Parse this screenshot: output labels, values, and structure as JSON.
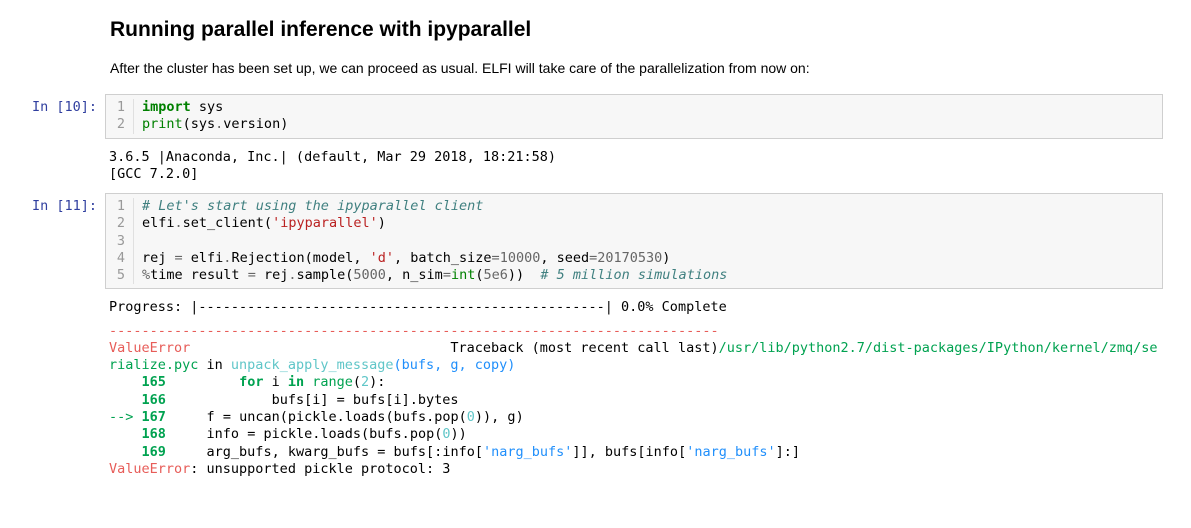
{
  "heading": "Running parallel inference with ipyparallel",
  "intro": "After the cluster has been set up, we can proceed as usual. ELFI will take care of the parallelization from now on:",
  "cells": [
    {
      "prompt": "In [10]:",
      "code": {
        "lines": [
          "1",
          "2"
        ],
        "l1_import": "import",
        "l1_sys": " sys",
        "l2_print": "print",
        "l2_open": "(sys",
        "l2_dot": ".",
        "l2_version": "version)"
      },
      "output": "3.6.5 |Anaconda, Inc.| (default, Mar 29 2018, 18:21:58) \n[GCC 7.2.0]"
    },
    {
      "prompt": "In [11]:",
      "code": {
        "lines": [
          "1",
          "2",
          "3",
          "4",
          "5"
        ],
        "l1_cm": "# Let's start using the ipyparallel client",
        "l2_a": "elfi",
        "l2_b": ".",
        "l2_c": "set_client(",
        "l2_str": "'ipyparallel'",
        "l2_d": ")",
        "l4_a": "rej ",
        "l4_eq": "=",
        "l4_b": " elfi",
        "l4_dot1": ".",
        "l4_c": "Rejection(model, ",
        "l4_str": "'d'",
        "l4_d": ", batch_size",
        "l4_eq2": "=",
        "l4_num1": "10000",
        "l4_e": ", seed",
        "l4_eq3": "=",
        "l4_num2": "20170530",
        "l4_f": ")",
        "l5_mag": "%",
        "l5_time": "time",
        "l5_a": " result ",
        "l5_eq": "=",
        "l5_b": " rej",
        "l5_dot": ".",
        "l5_c": "sample(",
        "l5_num1": "5000",
        "l5_d": ", n_sim",
        "l5_eq2": "=",
        "l5_int": "int",
        "l5_e": "(",
        "l5_num2": "5e6",
        "l5_f": "))  ",
        "l5_cm": "# 5 million simulations"
      },
      "progress": "Progress: |--------------------------------------------------| 0.0% Complete",
      "tb": {
        "dash": "---------------------------------------------------------------------------",
        "err_name": "ValueError",
        "err_label": "                                Traceback (most recent call last)",
        "path": "/usr/lib/python2.7/dist-packages/IPython/kernel/zmq/serialize.pyc",
        "in_word": " in ",
        "func": "unpack_apply_message",
        "sig_open": "(bufs, g, copy)",
        "l165n": "    165",
        "l165": "         for i in range(2):",
        "l165_for": "for",
        "l165_i": " i ",
        "l165_in": "in",
        "l165_sp": " ",
        "l165_range": "range",
        "l165_open": "(",
        "l165_two": "2",
        "l165_close": "):",
        "l166n": "    166",
        "l166_pre": "             bufs[i] ",
        "l166_bufs": "bufs",
        "l166_op": "=",
        "l166_rest": " bufs[i].bytes",
        "arrow": "--> ",
        "l167n": "167",
        "l167_pre": "     f ",
        "l167_eq": "=",
        "l167_a": " uncan",
        "l167_open": "(",
        "l167_b": "pickle",
        "l167_dot": ".",
        "l167_c": "loads",
        "l167_open2": "(",
        "l167_d": "bufs",
        "l167_dot2": ".",
        "l167_e": "pop",
        "l167_open3": "(",
        "l167_zero": "0",
        "l167_close3": ")),",
        "l167_g": " g",
        "l167_close": ")",
        "l168n": "    168",
        "l168_pre": "     info ",
        "l168_eq": "=",
        "l168_a": " pickle",
        "l168_dot": ".",
        "l168_b": "loads",
        "l168_open": "(",
        "l168_c": "bufs",
        "l168_dot2": ".",
        "l168_d": "pop",
        "l168_open2": "(",
        "l168_zero": "0",
        "l168_close": "))",
        "l169n": "    169",
        "l169_pre": "     arg_bufs",
        "l169_comma": ",",
        "l169_b": " kwarg_bufs ",
        "l169_eq": "=",
        "l169_c": " bufs",
        "l169_open": "[:",
        "l169_d": "info",
        "l169_open2": "[",
        "l169_str": "'narg_bufs'",
        "l169_close2": "]],",
        "l169_e": " bufs",
        "l169_open3": "[",
        "l169_f": "info",
        "l169_open4": "[",
        "l169_str2": "'narg_bufs'",
        "l169_close4": "]:]",
        "final_err": "ValueError",
        "final_msg": ": unsupported pickle protocol: 3"
      }
    }
  ]
}
